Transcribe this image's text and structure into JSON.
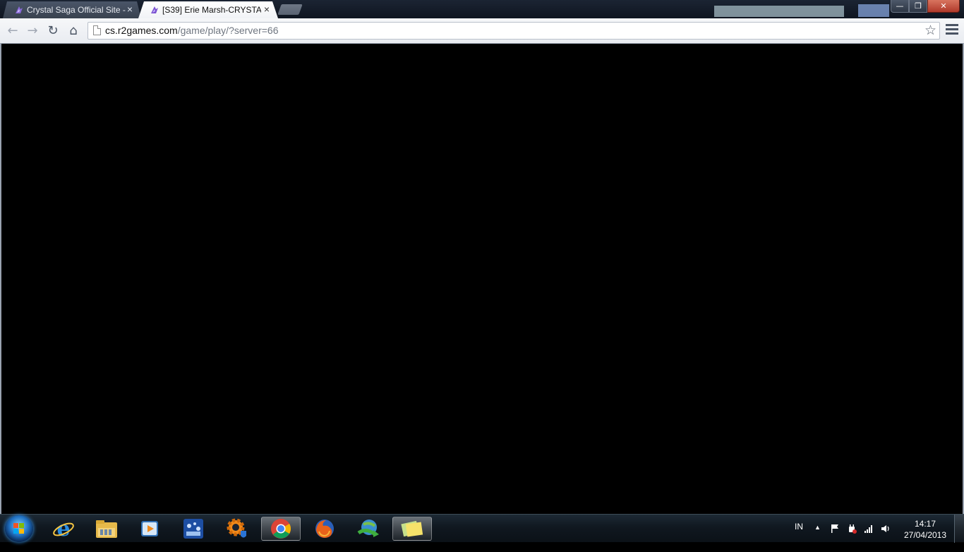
{
  "browser": {
    "tabs": [
      {
        "title": "Crystal Saga Official Site -",
        "active": false,
        "favicon": "crystal-saga-favicon"
      },
      {
        "title": "[S39] Erie Marsh-CRYSTAL",
        "active": true,
        "favicon": "crystal-saga-favicon"
      }
    ],
    "tab_close_glyph": "×",
    "window_buttons": {
      "minimize": "—",
      "maximize": "❐",
      "close": "✕"
    },
    "nav": {
      "back": "←",
      "forward": "→",
      "reload": "↻",
      "home": "⌂"
    },
    "omnibox": {
      "host": "cs.r2games.com",
      "path": "/game/play/?server=66"
    },
    "bookmark_star": "☆"
  },
  "taskbar": {
    "pinned": [
      {
        "name": "internet-explorer-icon",
        "active": false
      },
      {
        "name": "windows-explorer-icon",
        "active": false
      },
      {
        "name": "media-player-icon",
        "active": false
      },
      {
        "name": "movie-maker-icon",
        "active": false
      },
      {
        "name": "system-tool-icon",
        "active": false
      },
      {
        "name": "chrome-icon",
        "active": true
      },
      {
        "name": "firefox-icon",
        "active": false
      },
      {
        "name": "download-manager-icon",
        "active": false
      },
      {
        "name": "sticky-notes-icon",
        "active": true
      }
    ],
    "tray": {
      "language": "IN",
      "show_hidden": "▲",
      "time": "14:17",
      "date": "27/04/2013"
    }
  },
  "colors": {
    "content_bg": "#000000",
    "taskbar_bg": "#101820",
    "tab_active_bg": "#ffffff",
    "close_button": "#c24a37"
  }
}
